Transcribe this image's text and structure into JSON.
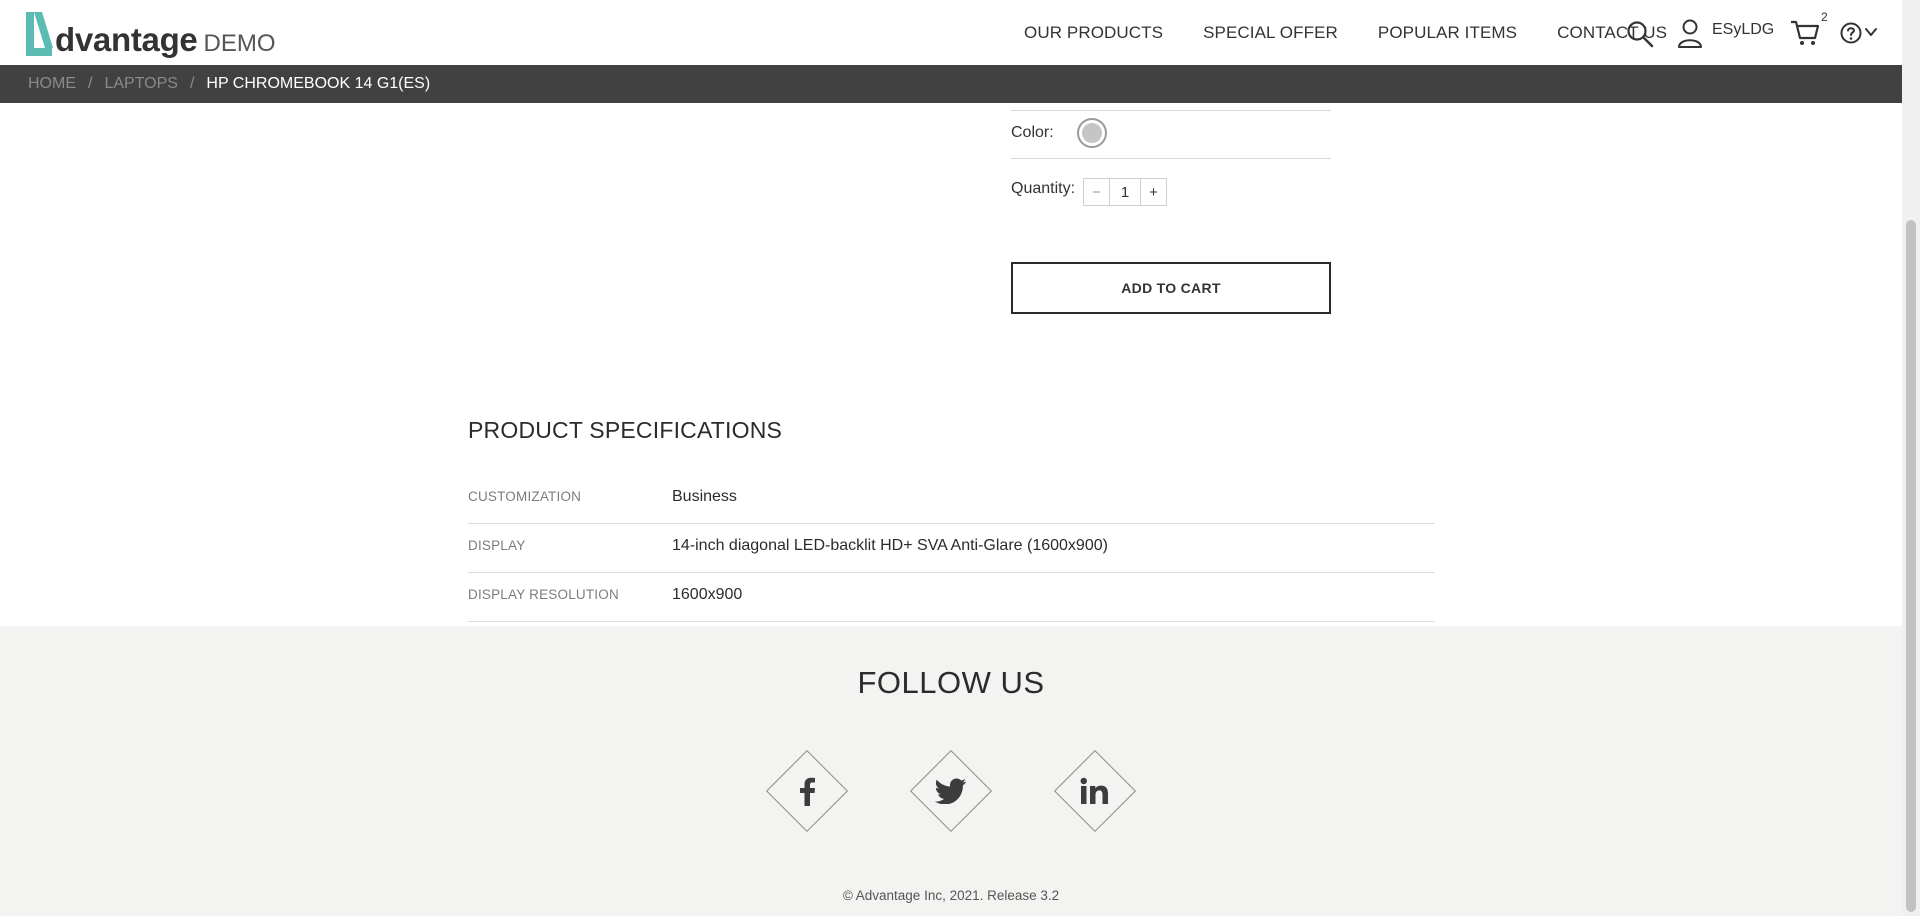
{
  "header": {
    "logo_word": "dvantage",
    "logo_demo": "DEMO",
    "nav": [
      "OUR PRODUCTS",
      "SPECIAL OFFER",
      "POPULAR ITEMS",
      "CONTACT US"
    ],
    "username": "ESyLDG",
    "cart_count": "2"
  },
  "breadcrumb": {
    "items": [
      "HOME",
      "LAPTOPS"
    ],
    "separator": "/",
    "current": "HP CHROMEBOOK 14 G1(ES)"
  },
  "product": {
    "color_label": "Color:",
    "selected_color": "#c5c5c5",
    "quantity_label": "Quantity:",
    "quantity_minus": "−",
    "quantity_value": "1",
    "quantity_plus": "+",
    "add_to_cart": "ADD TO CART"
  },
  "specs": {
    "title": "PRODUCT SPECIFICATIONS",
    "rows": [
      {
        "key": "CUSTOMIZATION",
        "value": "Business"
      },
      {
        "key": "DISPLAY",
        "value": "14-inch diagonal LED-backlit HD+ SVA Anti-Glare (1600x900)"
      },
      {
        "key": "DISPLAY RESOLUTION",
        "value": "1600x900"
      }
    ]
  },
  "footer": {
    "follow_title": "FOLLOW US",
    "social": [
      "facebook-icon",
      "twitter-icon",
      "linkedin-icon"
    ],
    "copyright": "© Advantage Inc, 2021. Release 3.2"
  },
  "colors": {
    "brand_teal": "#5cbcb3",
    "breadcrumb_bg": "#414141",
    "footer_bg": "#f3f3f1"
  }
}
